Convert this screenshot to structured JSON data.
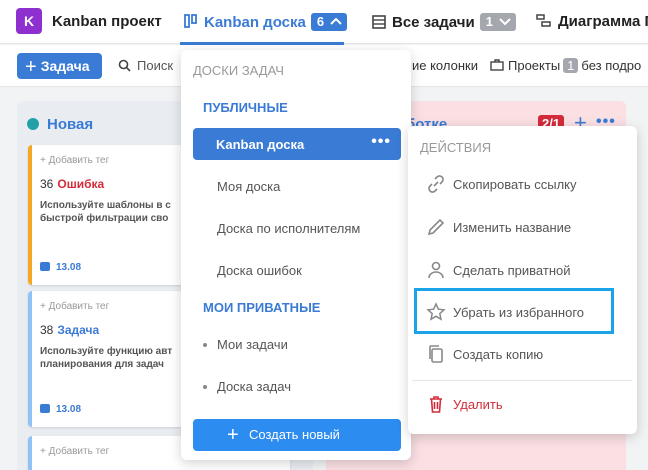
{
  "header": {
    "project_badge": "K",
    "project_name": "Kanban проект",
    "tabs": [
      {
        "label": "Kanban доска",
        "count": "6",
        "active": true
      },
      {
        "label": "Все задачи",
        "count": "1"
      },
      {
        "label": "Диаграмма Г"
      }
    ]
  },
  "toolbar": {
    "add_label": "Задача",
    "search_label": "Поиск",
    "columns_label": "ие колонки",
    "projects_label": "Проекты",
    "projects_count": "1",
    "projects_suffix": "без подро"
  },
  "board": {
    "col_new": {
      "title": "Новая",
      "color": "#21a0a8"
    },
    "col_work": {
      "title": "ботке",
      "limit": "2/1",
      "color": "#fadfe3"
    },
    "cards": [
      {
        "tag": "+ Добавить тег",
        "num": "36",
        "name": "Ошибка",
        "name_color": "#d42b3a",
        "bar_color": "#f5a623",
        "desc1": "Используйте шаблоны в с",
        "desc2": "быстрой фильтрации сво",
        "date": "13.08"
      },
      {
        "tag": "+ Добавить тег",
        "num": "38",
        "name": "Задача",
        "name_color": "#3a7bd5",
        "bar_color": "#8fc3f5",
        "desc1": "Используйте функцию авт",
        "desc2": "планирования для задач",
        "date": "13.08"
      },
      {
        "tag": "+ Добавить тег",
        "num": "",
        "name": "",
        "name_color": "#3a7bd5",
        "bar_color": "#8fc3f5",
        "desc1": "",
        "desc2": "",
        "date": ""
      }
    ]
  },
  "boards_menu": {
    "heading": "ДОСКИ ЗАДАЧ",
    "public_section": "ПУБЛИЧНЫЕ",
    "public_items": [
      "Kanban доска",
      "Моя доска",
      "Доска по исполнителям",
      "Доска ошибок"
    ],
    "private_section": "МОИ ПРИВАТНЫЕ",
    "private_items": [
      "Мои задачи",
      "Доска задач"
    ],
    "create_label": "Создать новый"
  },
  "actions_menu": {
    "heading": "ДЕЙСТВИЯ",
    "items": [
      {
        "label": "Скопировать ссылку",
        "icon": "link-icon"
      },
      {
        "label": "Изменить название",
        "icon": "pencil-icon"
      },
      {
        "label": "Сделать приватной",
        "icon": "user-icon"
      },
      {
        "label": "Убрать из избранного",
        "icon": "star-icon"
      },
      {
        "label": "Создать копию",
        "icon": "copy-icon"
      },
      {
        "label": "Удалить",
        "icon": "trash-icon"
      }
    ],
    "danger_color": "#d42b3a",
    "highlight_color": "#1aa3e8"
  }
}
